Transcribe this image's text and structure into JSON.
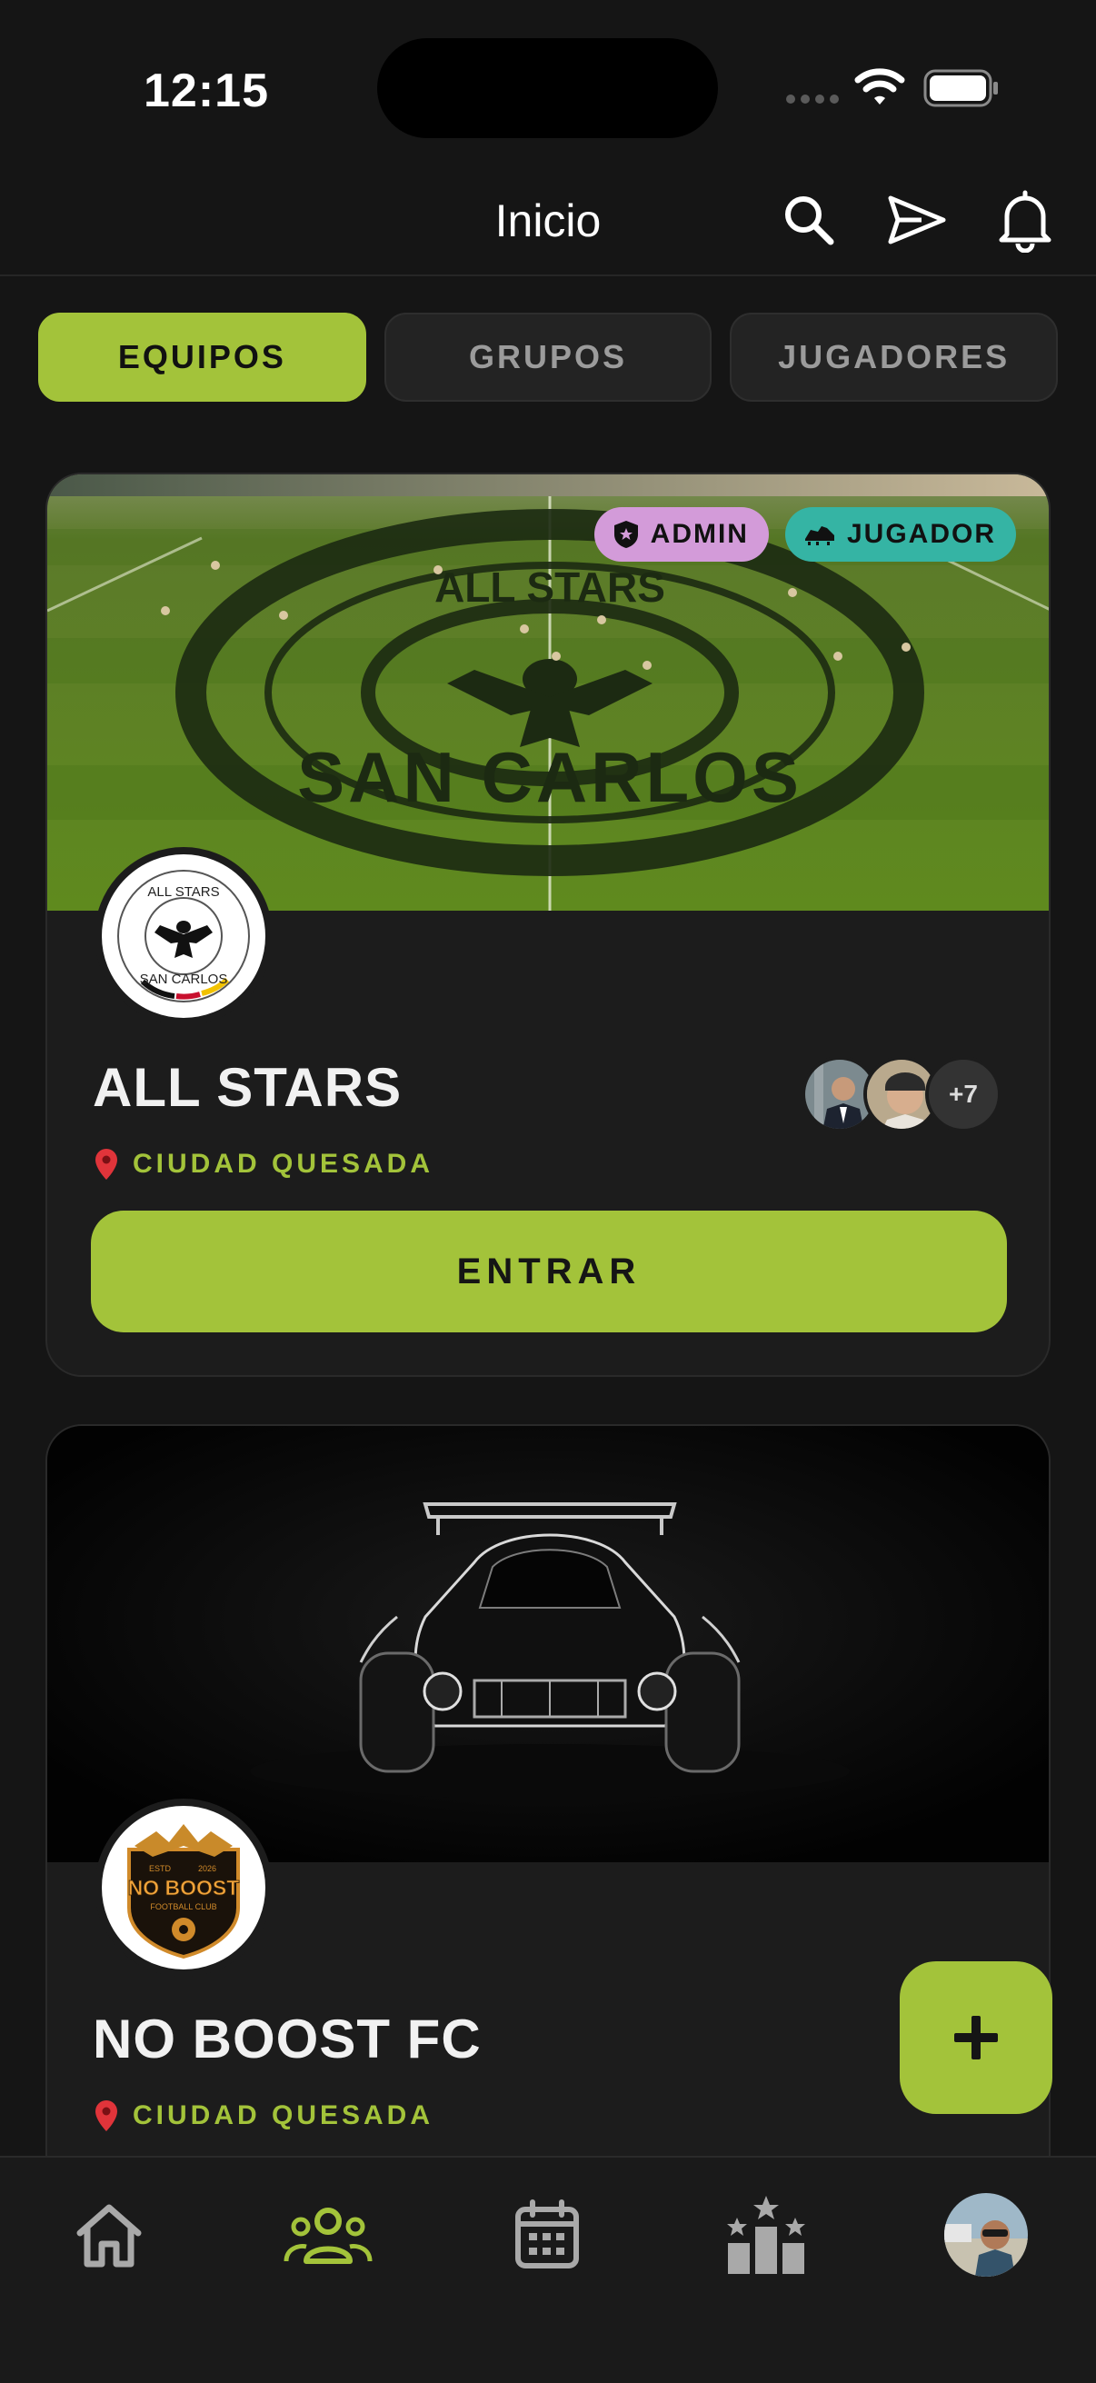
{
  "status_bar": {
    "time": "12:15"
  },
  "header": {
    "title": "Inicio",
    "icons": [
      "search-icon",
      "send-icon",
      "bell-icon"
    ]
  },
  "tabs": [
    {
      "label": "EQUIPOS",
      "active": true
    },
    {
      "label": "GRUPOS",
      "active": false
    },
    {
      "label": "JUGADORES",
      "active": false
    }
  ],
  "teams": [
    {
      "name": "ALL STARS",
      "location": "CIUDAD QUESADA",
      "roles": [
        "ADMIN",
        "JUGADOR"
      ],
      "cover_text_top": "ALL STARS",
      "cover_text_bottom": "SAN CARLOS",
      "logo_text_top": "ALL STARS",
      "logo_text_bottom": "SAN CARLOS",
      "extra_members": "+7",
      "enter_label": "ENTRAR"
    },
    {
      "name": "NO BOOST FC",
      "location": "CIUDAD QUESADA",
      "logo_text": "NO BOOST",
      "logo_subtext": "FOOTBALL CLUB",
      "logo_est": "ESTD",
      "logo_year": "2026"
    }
  ],
  "fab": {
    "icon": "plus-icon"
  },
  "bottom_nav": [
    {
      "icon": "home-icon",
      "active": false
    },
    {
      "icon": "team-icon",
      "active": true
    },
    {
      "icon": "calendar-icon",
      "active": false
    },
    {
      "icon": "ranking-icon",
      "active": false
    },
    {
      "icon": "profile-avatar",
      "active": false
    }
  ],
  "colors": {
    "accent": "#a3c33a",
    "background": "#151515",
    "card": "#1c1c1c",
    "admin_badge": "#d39bd9",
    "player_badge": "#35b4a4"
  }
}
